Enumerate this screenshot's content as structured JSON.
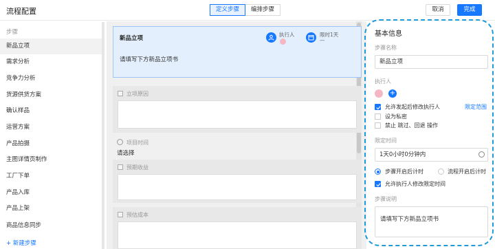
{
  "header": {
    "title": "流程配置",
    "tabs": [
      "定义步骤",
      "编排步骤"
    ],
    "cancel_label": "取消",
    "done_label": "完成"
  },
  "sidebar": {
    "heading": "步骤",
    "items": [
      "新品立项",
      "需求分析",
      "竞争力分析",
      "货源供货方案",
      "确认样品",
      "运营方案",
      "产品拍摄",
      "主图详情页制作",
      "工厂下单",
      "产品入库",
      "产品上架",
      "商品信息同步"
    ],
    "add_label": "+ 新建步骤"
  },
  "step_card": {
    "title": "新品立项",
    "description": "请填写下方新品立项书",
    "executor_label": "执行人",
    "time_limit_label": "限时1天",
    "time_limit_value": "—"
  },
  "form": {
    "field1_label": "立项原因",
    "project_time_label": "项目时间",
    "project_time_value": "请选择",
    "field2_label": "预期收益",
    "field3_label": "预估成本"
  },
  "panel": {
    "title": "基本信息",
    "step_name_label": "步骤名称",
    "step_name_value": "新品立项",
    "executor_label": "执行人",
    "cb_modify_executor": "允许发起后修改执行人",
    "limit_scope_link": "限定范围",
    "cb_private": "设为私密",
    "cb_forbid": "禁止 跳过、回退 操作",
    "time_label": "限定时间",
    "time_value": "1天0小时0分钟内",
    "radio_step_start": "步骤开启后计时",
    "radio_flow_start": "流程开启后计时",
    "cb_allow_modify_time": "允许执行人修改限定时间",
    "desc_label": "步骤说明",
    "desc_value": "请填写下方新品立项书"
  },
  "colors": {
    "accent": "#1677ff",
    "dashed_highlight": "#1e9bd7",
    "card_bg": "#e3effd"
  }
}
